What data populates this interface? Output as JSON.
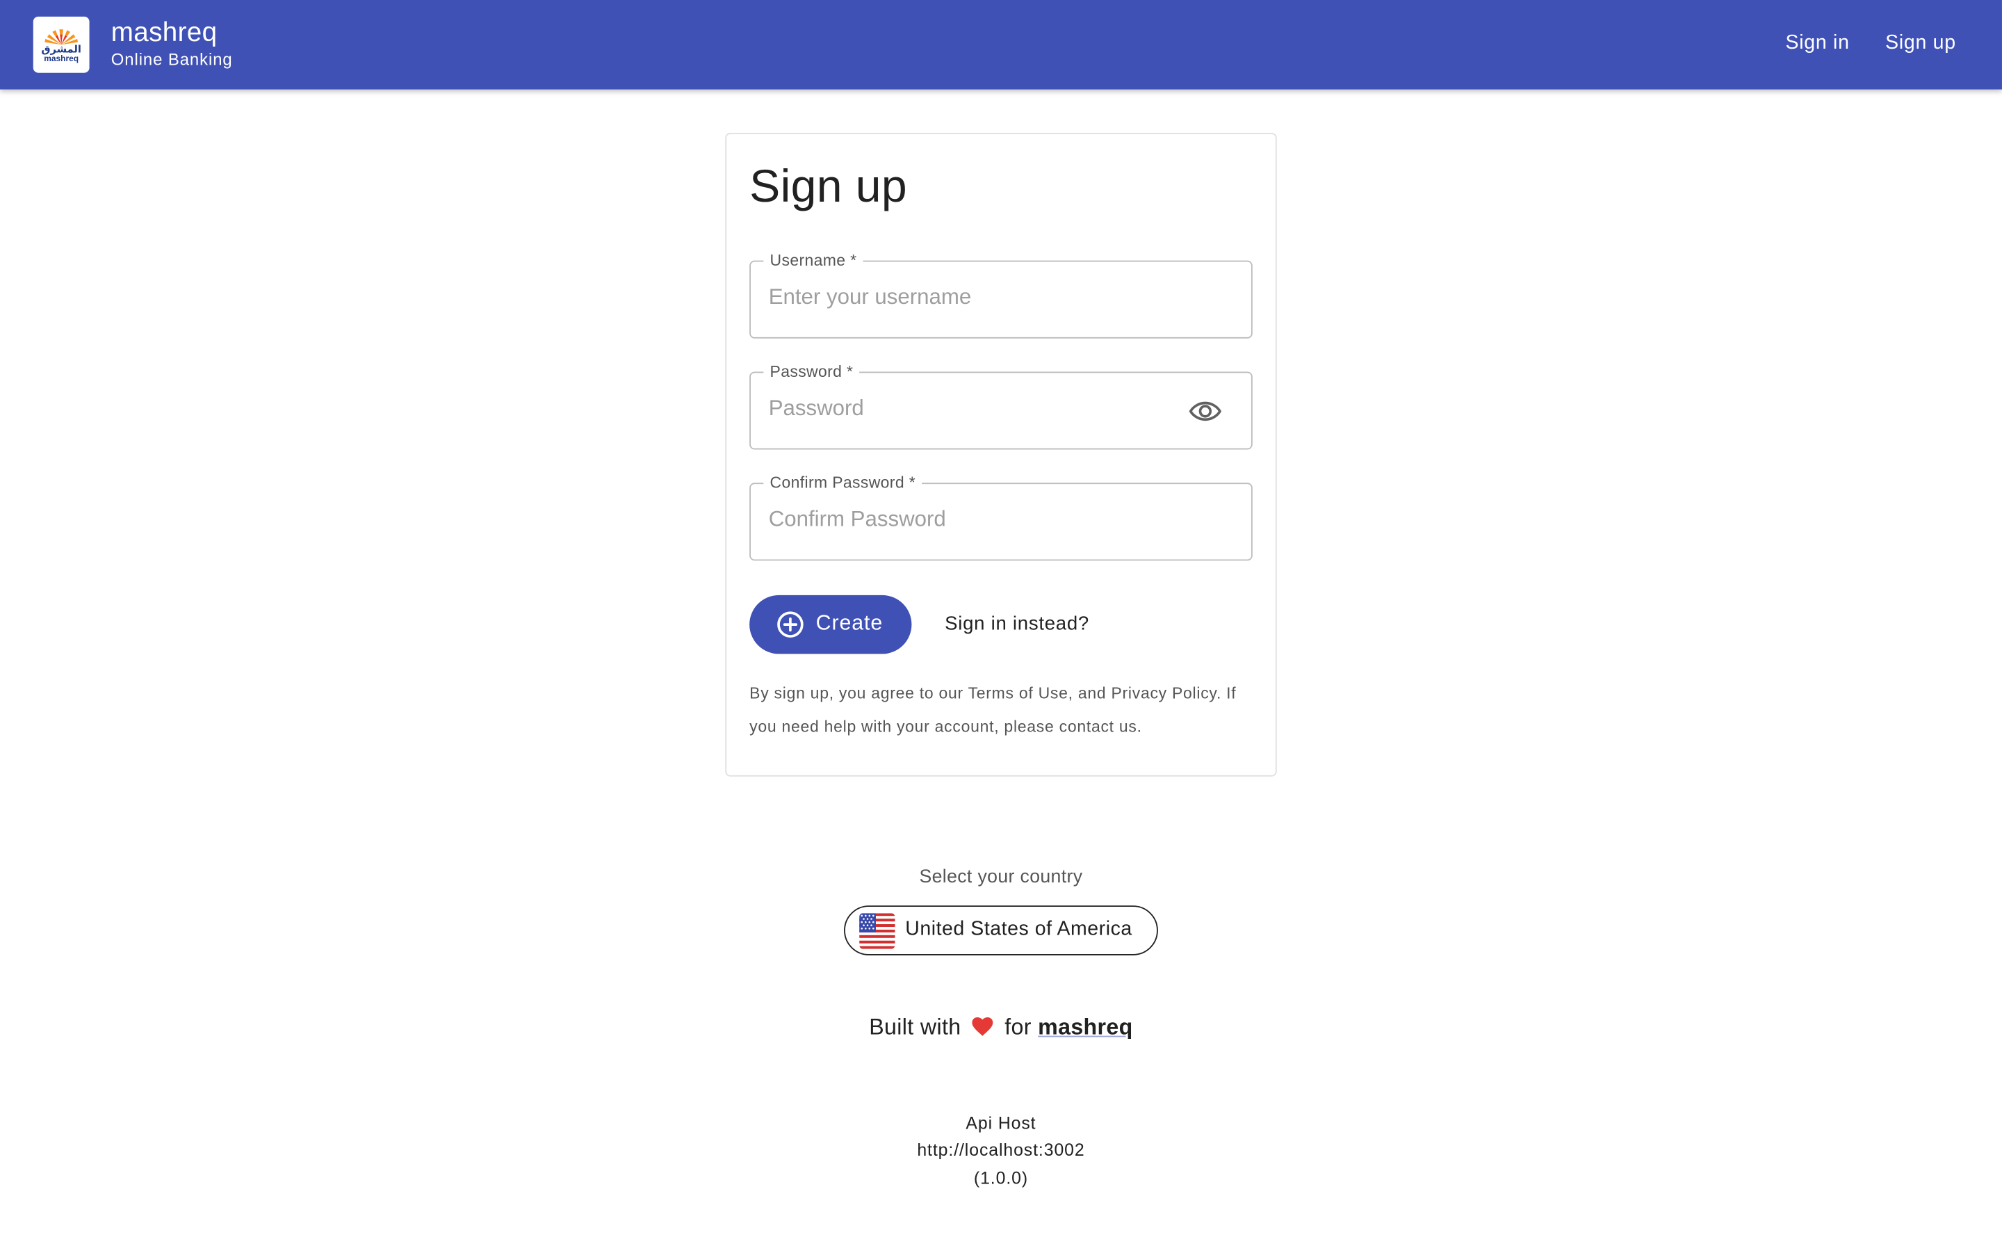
{
  "header": {
    "logo_text_ar": "المشرق",
    "logo_text_en": "mashreq",
    "brand_name": "mashreq",
    "brand_subtitle": "Online Banking",
    "nav": {
      "signin_label": "Sign in",
      "signup_label": "Sign up"
    },
    "bar_color": "#3f51b5"
  },
  "form": {
    "title": "Sign up",
    "username": {
      "label": "Username *",
      "placeholder": "Enter your username",
      "value": ""
    },
    "password": {
      "label": "Password *",
      "placeholder": "Password",
      "value": "",
      "toggle_icon": "eye-icon"
    },
    "confirm_password": {
      "label": "Confirm Password *",
      "placeholder": "Confirm Password",
      "value": ""
    },
    "create_label": "Create",
    "create_icon": "add-circle-icon",
    "signin_link": "Sign in instead?",
    "terms_text": "By sign up, you agree to our Terms of Use, and Privacy Policy. If you need help with your account, please contact us."
  },
  "footer": {
    "country_label": "Select your country",
    "country_name": "United States of America",
    "country_flag_icon": "us-flag-icon",
    "built_prefix": "Built with",
    "built_heart_icon": "heart-icon",
    "built_for": "for",
    "built_brand": "mashreq",
    "api_label": "Api Host",
    "api_host": "http://localhost:3002",
    "version": "(1.0.0)"
  },
  "colors": {
    "primary": "#3f51b5",
    "heart": "#e53935"
  }
}
